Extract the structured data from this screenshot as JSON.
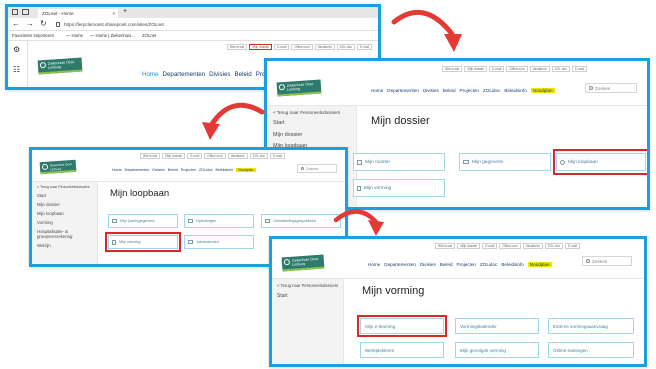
{
  "utility_links": [
    "Wie is wie",
    "Mijn dossier",
    "E-mail",
    "Office.com",
    "Vacatures",
    "ZOL.doc",
    "E-mail"
  ],
  "logo_text": "Ziekenhuis Oost-Limburg",
  "menu": {
    "home": "Home",
    "departementen": "Departementen",
    "divisies": "Divisies",
    "beleid": "Beleid",
    "projecten": "Projecten",
    "zolidoc": "ZOLidoc",
    "beleidsinfo": "Beleidsinfo",
    "noodplan": "Noodplan",
    "caret": "˅"
  },
  "search_placeholder": "Zoeken",
  "panel1": {
    "tab_title": "ZOLnet - Home",
    "tab_close": "×",
    "new_tab": "+",
    "nav_back": "←",
    "nav_forward": "→",
    "nav_refresh": "↻",
    "url": "https://lerpclaroosst.sharepoint.com/sites/ZOLnet",
    "fav_import": "Favorieten importeren",
    "fav_home": "— Home",
    "fav_home2": "— Home | Ziekenhuis...",
    "fav_zolnet": "ZOLnet",
    "rail_gear": "⚙",
    "rail_grid": "☷"
  },
  "panel2": {
    "back_link": "< Terug naar Personeelsdossiers",
    "sidebar": [
      "Start",
      "Mijn dossier",
      "Mijn loopbaan"
    ],
    "title": "Mijn dossier",
    "tiles": [
      "Mijn rooster",
      "Mijn gegevens",
      "Mijn loopbaan",
      "Mijn vorming"
    ]
  },
  "panel3": {
    "back_link": "< Terug naar Personeelsdossiers",
    "sidebar": [
      "Start",
      "Mijn dossier",
      "Mijn loopbaan",
      "Vorming",
      "Hospitalisatie- & groepsverzekering",
      "Welzijn"
    ],
    "title": "Mijn loopbaan",
    "tiles": [
      "Mijn (werk)gegevens",
      "Opleidingen",
      "Ontwikkelingsgesprekken",
      "Mijn vorming",
      "Jobstudenten"
    ]
  },
  "panel4": {
    "back_link": "< Terug naar Personeelsdossiers",
    "sidebar": [
      "Start"
    ],
    "title": "Mijn vorming",
    "tiles": [
      "Mijn e-learning",
      "Vormingskalender",
      "Externe vormingsaanvraag",
      "Werkplekleren",
      "Mijn gevolgde vorming",
      "Online trainingen"
    ]
  },
  "colors": {
    "frame": "#1aa0e0",
    "highlight": "#d42a2a",
    "arrow": "#e53935",
    "menu_highlight": "#f2e600",
    "logo": "#2e7a6c",
    "tile_border": "#9fd9e8"
  }
}
